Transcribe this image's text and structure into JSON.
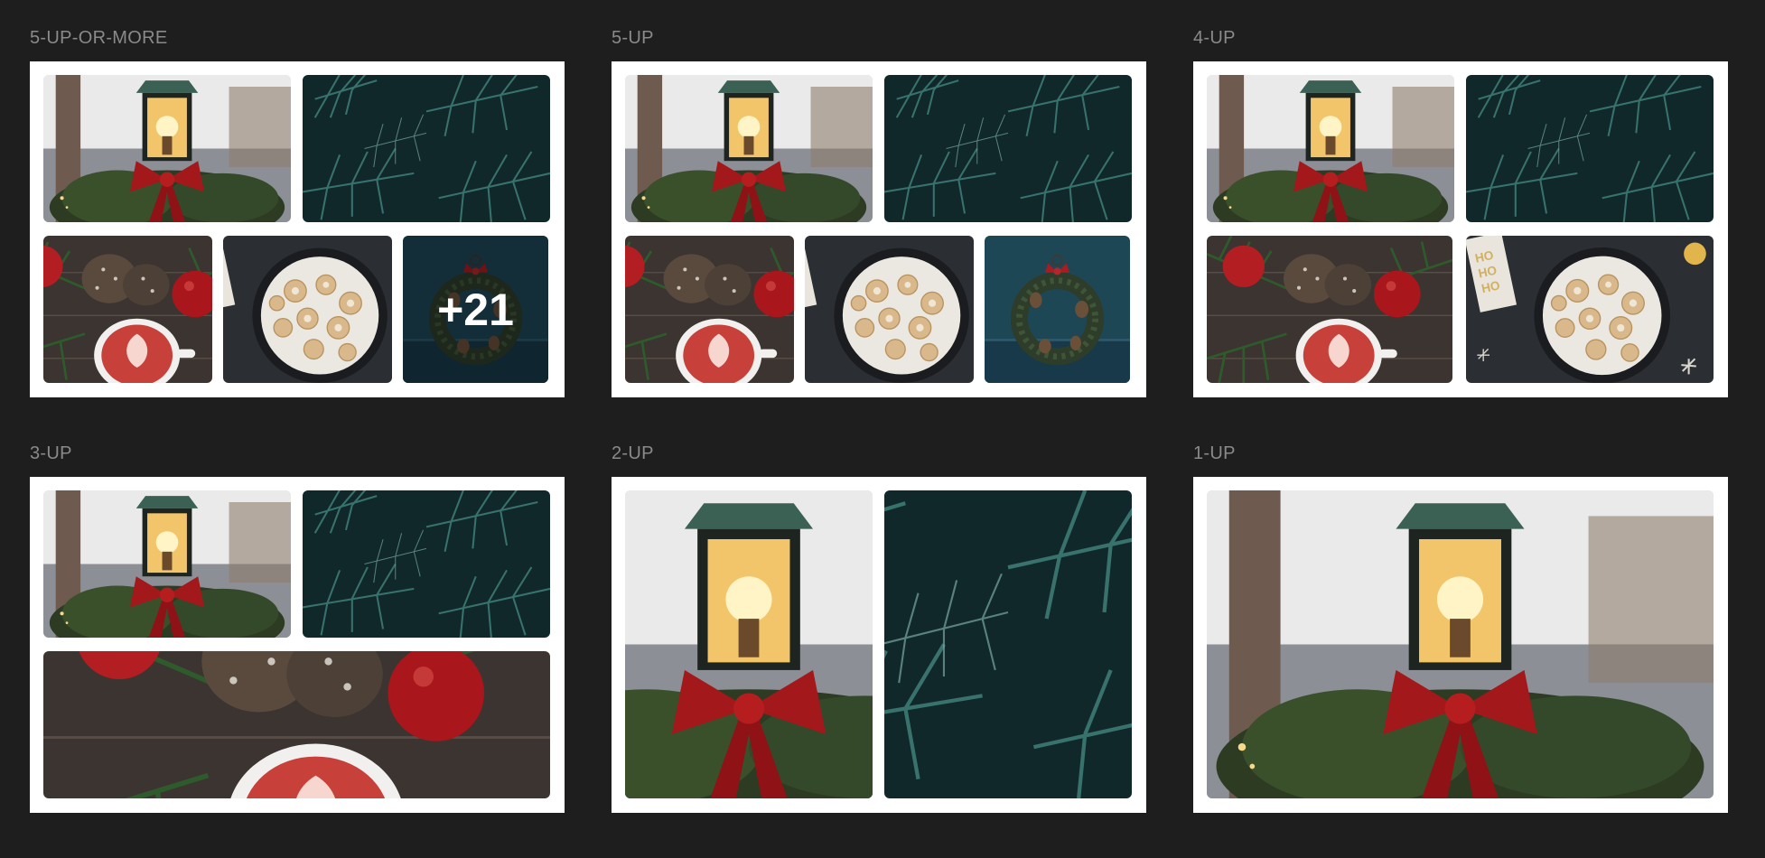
{
  "sections": [
    {
      "label": "5-UP-OR-MORE",
      "more_count": "+21"
    },
    {
      "label": "5-UP"
    },
    {
      "label": "4-UP"
    },
    {
      "label": "3-UP"
    },
    {
      "label": "2-UP"
    },
    {
      "label": "1-UP"
    }
  ],
  "photos": {
    "lamp": "lamp-photo",
    "branches": "pine-branches-photo",
    "cocoa": "cocoa-pinecones-photo",
    "cookies": "cookies-plate-photo",
    "wreath": "wreath-door-photo"
  }
}
